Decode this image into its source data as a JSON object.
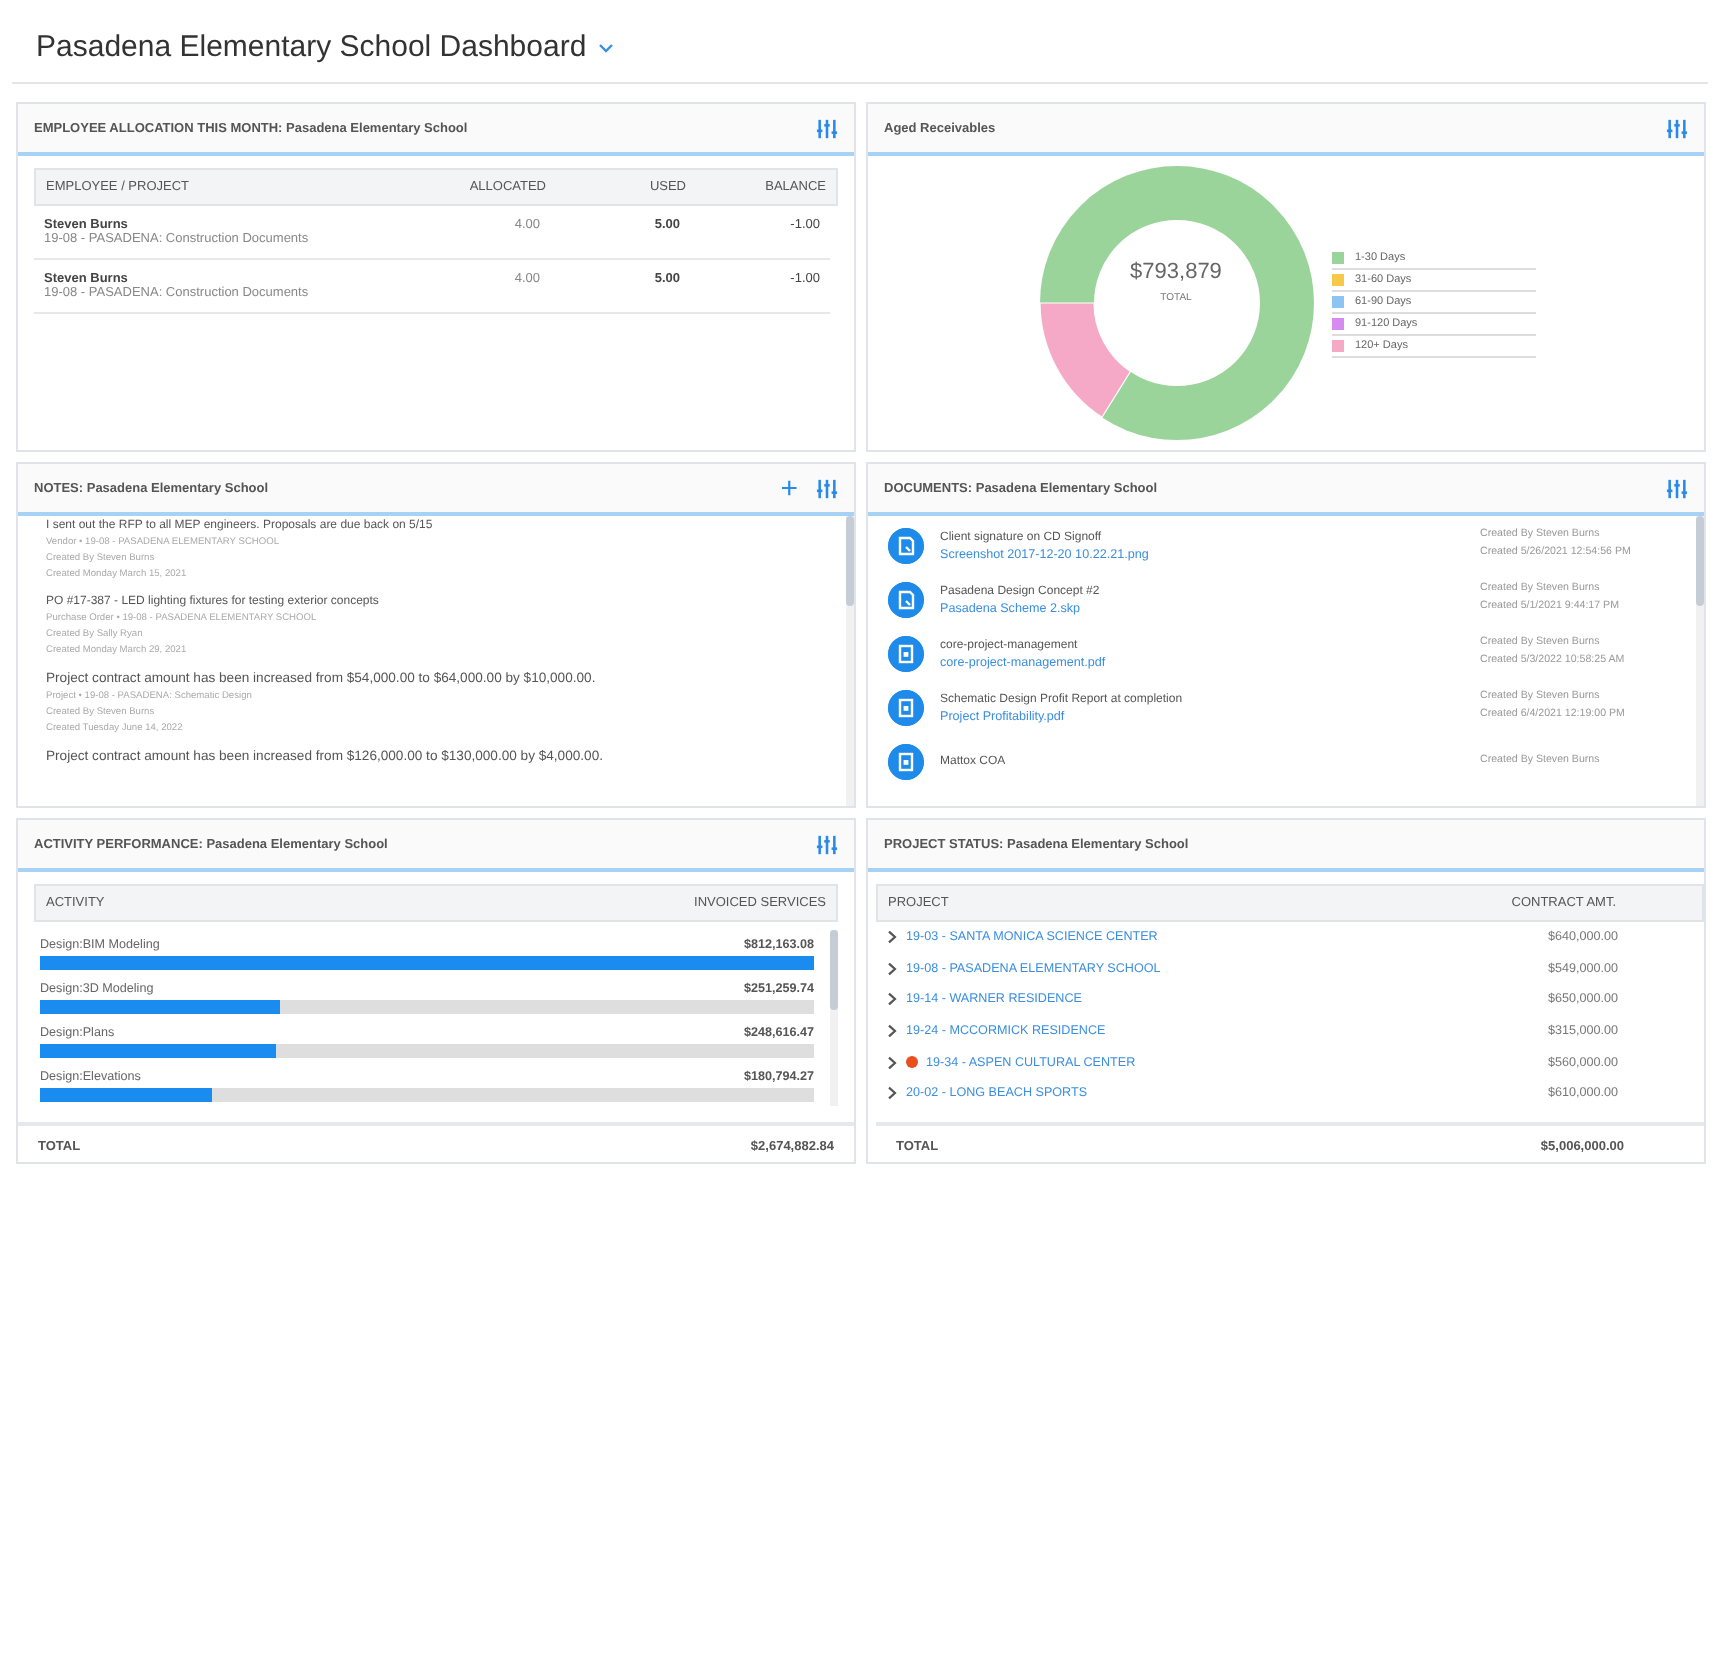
{
  "page": {
    "title": "Pasadena Elementary School Dashboard"
  },
  "employee_allocation": {
    "title": "EMPLOYEE ALLOCATION THIS MONTH: Pasadena Elementary School",
    "columns": [
      "EMPLOYEE / PROJECT",
      "ALLOCATED",
      "USED",
      "BALANCE"
    ],
    "rows": [
      {
        "employee": "Steven Burns",
        "project": "19-08 - PASADENA: Construction Documents",
        "allocated": "4.00",
        "used": "5.00",
        "balance": "-1.00"
      },
      {
        "employee": "Steven Burns",
        "project": "19-08 - PASADENA: Construction Documents",
        "allocated": "4.00",
        "used": "5.00",
        "balance": "-1.00"
      }
    ]
  },
  "aged_receivables": {
    "title": "Aged Receivables",
    "total": "$793,879",
    "total_label": "TOTAL",
    "legend": [
      {
        "label": "1-30 Days",
        "color": "#9bd49a"
      },
      {
        "label": "31-60 Days",
        "color": "#f7c948"
      },
      {
        "label": "61-90 Days",
        "color": "#8cc4f2"
      },
      {
        "label": "91-120 Days",
        "color": "#d98af0"
      },
      {
        "label": "120+ Days",
        "color": "#f5a9c6"
      }
    ]
  },
  "notes": {
    "title": "NOTES: Pasadena Elementary School",
    "add_icon": "+",
    "items": [
      {
        "text": "I sent out the RFP to all MEP engineers. Proposals are due back on 5/15",
        "source": "Vendor • 19-08 - PASADENA ELEMENTARY SCHOOL",
        "author": "Created By Steven Burns",
        "date": "Created Monday March 15, 2021",
        "emphasis": false
      },
      {
        "text": "PO #17-387 - LED lighting fixtures for testing exterior concepts",
        "source": "Purchase Order • 19-08 - PASADENA ELEMENTARY SCHOOL",
        "author": "Created By Sally Ryan",
        "date": "Created Monday March 29, 2021",
        "emphasis": false
      },
      {
        "text": "Project contract amount has been increased from $54,000.00 to $64,000.00 by $10,000.00.",
        "source": "Project • 19-08 - PASADENA: Schematic Design",
        "author": "Created By Steven Burns",
        "date": "Created Tuesday June 14, 2022",
        "emphasis": true
      },
      {
        "text": "Project contract amount has been increased from $126,000.00 to $130,000.00 by $4,000.00.",
        "emphasis": true
      }
    ]
  },
  "documents": {
    "title": "DOCUMENTS: Pasadena Elementary School",
    "items": [
      {
        "kind": "image",
        "name": "Client signature on CD Signoff",
        "file": "Screenshot 2017-12-20 10.22.21.png",
        "author": "Created By Steven Burns",
        "date": "Created 5/26/2021 12:54:56 PM"
      },
      {
        "kind": "image",
        "name": "Pasadena Design Concept #2",
        "file": "Pasadena Scheme 2.skp",
        "author": "Created By Steven Burns",
        "date": "Created 5/1/2021 9:44:17 PM"
      },
      {
        "kind": "pdf",
        "name": "core-project-management",
        "file": "core-project-management.pdf",
        "author": "Created By Steven Burns",
        "date": "Created 5/3/2022 10:58:25 AM"
      },
      {
        "kind": "pdf",
        "name": "Schematic Design Profit Report at completion",
        "file": "Project Profitability.pdf",
        "author": "Created By Steven Burns",
        "date": "Created 6/4/2021 12:19:00 PM"
      },
      {
        "kind": "pdf",
        "name": "Mattox COA",
        "author": "Created By Steven Burns"
      }
    ]
  },
  "activity_performance": {
    "title": "ACTIVITY PERFORMANCE: Pasadena Elementary School",
    "columns": [
      "ACTIVITY",
      "INVOICED SERVICES"
    ],
    "rows": [
      {
        "activity": "Design:BIM Modeling",
        "amount": "$812,163.08",
        "level": 1
      },
      {
        "activity": "Design:3D Modeling",
        "amount": "$251,259.74",
        "level": 0.31
      },
      {
        "activity": "Design:Plans",
        "amount": "$248,616.47",
        "level": 0.306
      },
      {
        "activity": "Design:Elevations",
        "amount": "$180,794.27",
        "level": 0.223
      }
    ],
    "total_label": "TOTAL",
    "total": "$2,674,882.84"
  },
  "project_status": {
    "title": "PROJECT STATUS: Pasadena Elementary School",
    "columns": [
      "PROJECT",
      "CONTRACT AMT."
    ],
    "rows": [
      {
        "project": "19-03 - SANTA MONICA SCIENCE CENTER",
        "amount": "$640,000.00",
        "alert": false
      },
      {
        "project": "19-08 - PASADENA ELEMENTARY SCHOOL",
        "amount": "$549,000.00",
        "alert": false
      },
      {
        "project": "19-14 - WARNER RESIDENCE",
        "amount": "$650,000.00",
        "alert": false
      },
      {
        "project": "19-24 - MCCORMICK RESIDENCE",
        "amount": "$315,000.00",
        "alert": false
      },
      {
        "project": "19-34 - ASPEN CULTURAL CENTER",
        "amount": "$560,000.00",
        "alert": true
      },
      {
        "project": "20-02 - LONG BEACH SPORTS",
        "amount": "$610,000.00",
        "alert": false
      }
    ],
    "total_label": "TOTAL",
    "total": "$5,006,000.00"
  }
}
